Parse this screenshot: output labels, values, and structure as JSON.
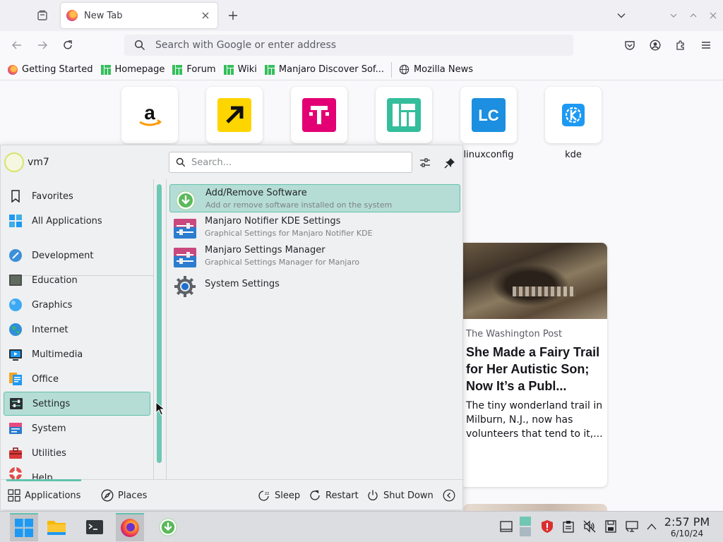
{
  "browser": {
    "tab": {
      "title": "New Tab"
    },
    "urlbar": {
      "placeholder": "Search with Google or enter address"
    },
    "bookmarks": [
      {
        "label": "Getting Started",
        "icon": "firefox-icon"
      },
      {
        "label": "Homepage",
        "icon": "manjaro-icon"
      },
      {
        "label": "Forum",
        "icon": "manjaro-icon"
      },
      {
        "label": "Wiki",
        "icon": "manjaro-icon"
      },
      {
        "label": "Manjaro Discover Sof...",
        "icon": "manjaro-icon"
      },
      {
        "label": "Mozilla News",
        "icon": "globe-icon"
      }
    ]
  },
  "newtab": {
    "top_sites": [
      {
        "label": "",
        "icon": "amazon-icon"
      },
      {
        "label": "",
        "icon": "arrow-icon"
      },
      {
        "label": "",
        "icon": "telekom-icon"
      },
      {
        "label": "",
        "icon": "manjaro-icon"
      },
      {
        "label": "linuxconfig",
        "icon": "lc-icon"
      },
      {
        "label": "kde",
        "icon": "kde-icon"
      }
    ],
    "story": {
      "source": "The Washington Post",
      "headline": "She Made a Fairy Trail for Her Autistic Son; Now It’s a Publ...",
      "excerpt": "The tiny wonderland trail in Milburn, N.J., now has volunteers that tend to it,..."
    }
  },
  "launcher": {
    "username": "vm7",
    "search_placeholder": "Search...",
    "categories": [
      {
        "label": "Favorites",
        "icon": "bookmark-icon"
      },
      {
        "label": "All Applications",
        "icon": "grid-icon"
      },
      {
        "label": "Development",
        "icon": "development-icon"
      },
      {
        "label": "Education",
        "icon": "education-icon"
      },
      {
        "label": "Graphics",
        "icon": "graphics-icon"
      },
      {
        "label": "Internet",
        "icon": "internet-icon"
      },
      {
        "label": "Multimedia",
        "icon": "multimedia-icon"
      },
      {
        "label": "Office",
        "icon": "office-icon"
      },
      {
        "label": "Settings",
        "icon": "settings-icon"
      },
      {
        "label": "System",
        "icon": "system-icon"
      },
      {
        "label": "Utilities",
        "icon": "utilities-icon"
      },
      {
        "label": "Help",
        "icon": "help-icon"
      }
    ],
    "active_category": "Settings",
    "apps": [
      {
        "name": "Add/Remove Software",
        "desc": "Add or remove software installed on the system",
        "icon": "download-icon"
      },
      {
        "name": "Manjaro Notifier KDE Settings",
        "desc": "Graphical Settings for Manjaro Notifier KDE",
        "icon": "sliders-icon"
      },
      {
        "name": "Manjaro Settings Manager",
        "desc": "Graphical Settings Manager for Manjaro",
        "icon": "sliders-icon"
      },
      {
        "name": "System Settings",
        "desc": "",
        "icon": "gear-icon"
      }
    ],
    "footer": {
      "applications": "Applications",
      "places": "Places",
      "sleep": "Sleep",
      "restart": "Restart",
      "shutdown": "Shut Down"
    }
  },
  "taskbar": {
    "time": "2:57 PM",
    "date": "6/10/24"
  },
  "colors": {
    "accent": "#61c1ad",
    "highlight": "#b5ddd6"
  }
}
